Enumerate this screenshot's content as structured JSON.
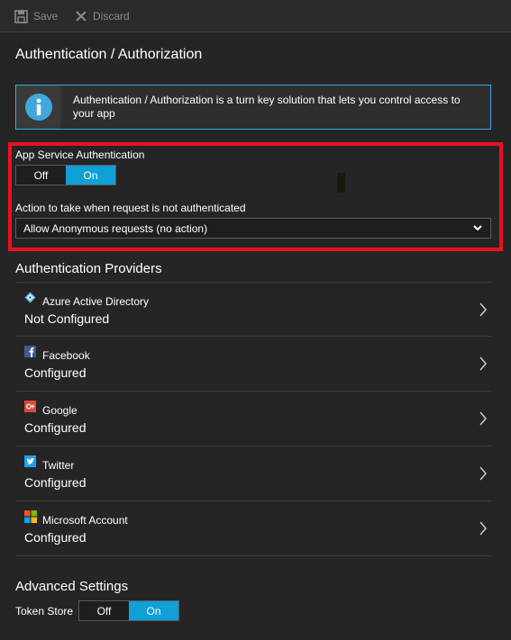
{
  "toolbar": {
    "save_label": "Save",
    "discard_label": "Discard"
  },
  "page": {
    "title": "Authentication / Authorization"
  },
  "info": {
    "icon": "info-icon",
    "text": "Authentication / Authorization is a turn key solution that lets you control access to your app"
  },
  "app_service_auth": {
    "label": "App Service Authentication",
    "off_label": "Off",
    "on_label": "On",
    "selected": "On"
  },
  "action": {
    "label": "Action to take when request is not authenticated",
    "selected_value": "Allow Anonymous requests (no action)"
  },
  "providers": {
    "title": "Authentication Providers",
    "items": [
      {
        "name": "Azure Active Directory",
        "status": "Not Configured",
        "icon": "azure-ad-icon"
      },
      {
        "name": "Facebook",
        "status": "Configured",
        "icon": "facebook-icon"
      },
      {
        "name": "Google",
        "status": "Configured",
        "icon": "google-icon"
      },
      {
        "name": "Twitter",
        "status": "Configured",
        "icon": "twitter-icon"
      },
      {
        "name": "Microsoft Account",
        "status": "Configured",
        "icon": "microsoft-icon"
      }
    ]
  },
  "advanced": {
    "title": "Advanced Settings",
    "token_store_label": "Token Store",
    "off_label": "Off",
    "on_label": "On",
    "selected": "On"
  },
  "colors": {
    "accent": "#0fa0d8",
    "highlight_border": "#e81123",
    "background": "#252526"
  }
}
